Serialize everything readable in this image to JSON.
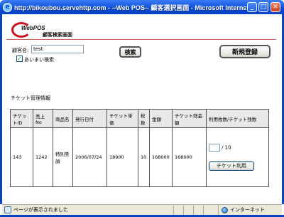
{
  "window": {
    "title": "http://bikoubou.servehttp.com - --Web POS-- 顧客選択画面 - Microsoft Internet Ex...",
    "min_glyph": "_",
    "max_glyph": "□",
    "close_glyph": "✕"
  },
  "header": {
    "logo_text": "WebPOS",
    "page_title": "顧客検索画面"
  },
  "search": {
    "name_label": "顧客名:",
    "name_value": "test",
    "fuzzy_checked": true,
    "fuzzy_label": "あいまい検索",
    "search_button": "検索",
    "new_button": "新規登録"
  },
  "tickets": {
    "section_title": "チケット管理情報",
    "columns": [
      "チケットID",
      "売上No",
      "商品名",
      "発行日付",
      "チケット単価",
      "枚数",
      "金額",
      "チケット残金額",
      "利用枚数/チケット残数"
    ],
    "rows": [
      {
        "ticket_id": "143",
        "sales_no": "1242",
        "product": "特別美顔",
        "issue_date": "2006/07/24",
        "unit_price": "18900",
        "quantity": "10",
        "amount": "168000",
        "remaining_amount": "168000",
        "usage_value": "",
        "remaining_count": "/ 10",
        "use_button": "チケット利用"
      }
    ]
  },
  "statusbar": {
    "status_text": "ページが表示されました",
    "zone": "インターネット"
  },
  "colors": {
    "titlebar": "#0a4bd9",
    "brand_red": "#d0101a"
  }
}
